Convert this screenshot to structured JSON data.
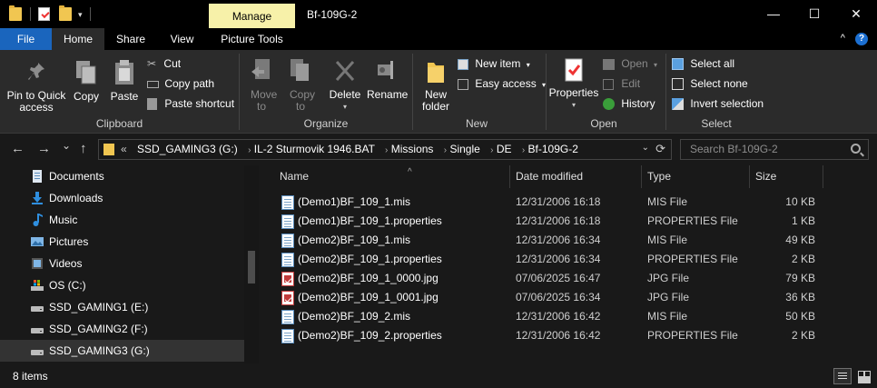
{
  "titlebar": {
    "context_tab": "Manage",
    "window_title": "Bf-109G-2",
    "dropdown_glyph": "▾",
    "minimize": "—",
    "maximize": "☐",
    "close": "✕"
  },
  "tabs": {
    "file": "File",
    "home": "Home",
    "share": "Share",
    "view": "View",
    "picture_tools": "Picture Tools",
    "collapse": "^",
    "help": "?"
  },
  "ribbon": {
    "clipboard": {
      "label": "Clipboard",
      "pin": "Pin to Quick access",
      "copy": "Copy",
      "paste": "Paste",
      "cut": "Cut",
      "copy_path": "Copy path",
      "paste_shortcut": "Paste shortcut"
    },
    "organize": {
      "label": "Organize",
      "move_to": "Move to",
      "copy_to": "Copy to",
      "delete": "Delete",
      "rename": "Rename"
    },
    "new": {
      "label": "New",
      "new_folder": "New folder",
      "new_item": "New item",
      "easy_access": "Easy access"
    },
    "open": {
      "label": "Open",
      "properties": "Properties",
      "open": "Open",
      "edit": "Edit",
      "history": "History"
    },
    "select": {
      "label": "Select",
      "select_all": "Select all",
      "select_none": "Select none",
      "invert_selection": "Invert selection"
    }
  },
  "nav": {
    "back": "←",
    "forward": "→",
    "recent": "⌄",
    "up": "↑",
    "overflow": "«",
    "breadcrumbs": [
      "SSD_GAMING3 (G:)",
      "IL-2 Sturmovik 1946.BAT",
      "Missions",
      "Single",
      "DE",
      "Bf-109G-2"
    ],
    "crumb_separator": "›",
    "dropdown": "⌄",
    "refresh": "⟳",
    "search_placeholder": "Search Bf-109G-2"
  },
  "sidebar": {
    "items": [
      {
        "label": "Documents",
        "icon": "documents-icon",
        "selected": false
      },
      {
        "label": "Downloads",
        "icon": "downloads-icon",
        "selected": false
      },
      {
        "label": "Music",
        "icon": "music-icon",
        "selected": false
      },
      {
        "label": "Pictures",
        "icon": "pictures-icon",
        "selected": false
      },
      {
        "label": "Videos",
        "icon": "videos-icon",
        "selected": false
      },
      {
        "label": "OS (C:)",
        "icon": "drive-c-icon",
        "selected": false
      },
      {
        "label": "SSD_GAMING1 (E:)",
        "icon": "drive-icon",
        "selected": false
      },
      {
        "label": "SSD_GAMING2 (F:)",
        "icon": "drive-icon",
        "selected": false
      },
      {
        "label": "SSD_GAMING3 (G:)",
        "icon": "drive-icon",
        "selected": true
      }
    ]
  },
  "filelist": {
    "columns": {
      "name": "Name",
      "date": "Date modified",
      "type": "Type",
      "size": "Size"
    },
    "sort_glyph": "^",
    "files": [
      {
        "name": "(Demo1)BF_109_1.mis",
        "date": "12/31/2006 16:18",
        "type": "MIS File",
        "size": "10 KB",
        "icon": "doc"
      },
      {
        "name": "(Demo1)BF_109_1.properties",
        "date": "12/31/2006 16:18",
        "type": "PROPERTIES File",
        "size": "1 KB",
        "icon": "doc"
      },
      {
        "name": "(Demo2)BF_109_1.mis",
        "date": "12/31/2006 16:34",
        "type": "MIS File",
        "size": "49 KB",
        "icon": "doc"
      },
      {
        "name": "(Demo2)BF_109_1.properties",
        "date": "12/31/2006 16:34",
        "type": "PROPERTIES File",
        "size": "2 KB",
        "icon": "doc"
      },
      {
        "name": "(Demo2)BF_109_1_0000.jpg",
        "date": "07/06/2025 16:47",
        "type": "JPG File",
        "size": "79 KB",
        "icon": "jpg"
      },
      {
        "name": "(Demo2)BF_109_1_0001.jpg",
        "date": "07/06/2025 16:34",
        "type": "JPG File",
        "size": "36 KB",
        "icon": "jpg"
      },
      {
        "name": "(Demo2)BF_109_2.mis",
        "date": "12/31/2006 16:42",
        "type": "MIS File",
        "size": "50 KB",
        "icon": "doc"
      },
      {
        "name": "(Demo2)BF_109_2.properties",
        "date": "12/31/2006 16:42",
        "type": "PROPERTIES File",
        "size": "2 KB",
        "icon": "doc"
      }
    ]
  },
  "status": {
    "item_count": "8 items"
  },
  "colors": {
    "accent": "#1a65bd",
    "context_tab": "#f7f1a9",
    "folder": "#f1c651",
    "background": "#191919",
    "ribbon": "#2b2b2b"
  }
}
